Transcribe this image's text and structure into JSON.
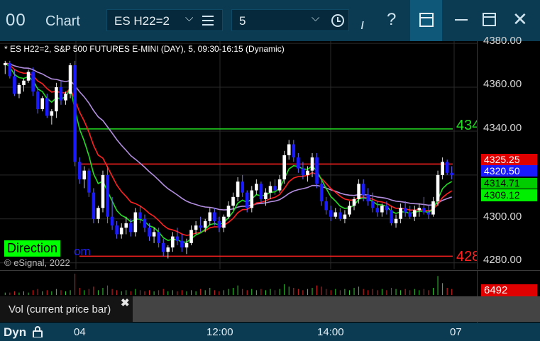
{
  "window": {
    "icon_text": "00",
    "title": "Chart",
    "symbol": "ES H22=2",
    "interval": "5"
  },
  "chart": {
    "header": "* ES H22=2, S&P 500 FUTURES E-MINI (DAY), 5, 09:30-16:15 (Dynamic)",
    "direction_label": "Direction",
    "direction_extra": "om",
    "copyright": "© eSignal, 2022",
    "green_line_label": "434",
    "red_line_label": "428",
    "price_ticks": [
      "4380.00",
      "4360.00",
      "4340.00",
      "4300.00",
      "4280.00"
    ],
    "badges": {
      "red_upper": "4325.25",
      "last_price": "4320.50",
      "green_upper": "4314.71",
      "green_lower": "4309.12"
    },
    "colors": {
      "up_candle": "#ffffff",
      "down_candle": "#1a1aff",
      "red_line": "#ff2020",
      "green_line": "#22dd22",
      "lavender_line": "#b38ee0"
    }
  },
  "volume": {
    "label": "Vol (current price bar)",
    "close": "✖",
    "value": "6492"
  },
  "time_axis": {
    "mode": "Dyn",
    "ticks": [
      "04",
      "12:00",
      "14:00",
      "07"
    ]
  },
  "chart_data": {
    "type": "candlestick",
    "ylim": [
      4277,
      4381
    ],
    "candles": [
      [
        4370,
        4372,
        4366,
        4371
      ],
      [
        4371,
        4372,
        4364,
        4365
      ],
      [
        4365,
        4368,
        4356,
        4357
      ],
      [
        4357,
        4362,
        4355,
        4361
      ],
      [
        4361,
        4364,
        4358,
        4363
      ],
      [
        4363,
        4368,
        4362,
        4367
      ],
      [
        4367,
        4369,
        4356,
        4358
      ],
      [
        4358,
        4360,
        4348,
        4350
      ],
      [
        4350,
        4356,
        4349,
        4355
      ],
      [
        4355,
        4357,
        4346,
        4347
      ],
      [
        4347,
        4350,
        4343,
        4349
      ],
      [
        4349,
        4362,
        4346,
        4360
      ],
      [
        4360,
        4363,
        4352,
        4354
      ],
      [
        4354,
        4358,
        4352,
        4357
      ],
      [
        4357,
        4371,
        4355,
        4370
      ],
      [
        4370,
        4372,
        4324,
        4326
      ],
      [
        4326,
        4328,
        4316,
        4318
      ],
      [
        4318,
        4324,
        4314,
        4322
      ],
      [
        4322,
        4323,
        4310,
        4312
      ],
      [
        4312,
        4314,
        4298,
        4300
      ],
      [
        4300,
        4306,
        4298,
        4305
      ],
      [
        4305,
        4322,
        4303,
        4320
      ],
      [
        4320,
        4324,
        4298,
        4301
      ],
      [
        4301,
        4310,
        4295,
        4297
      ],
      [
        4297,
        4299,
        4291,
        4293
      ],
      [
        4293,
        4298,
        4291,
        4296
      ],
      [
        4296,
        4301,
        4293,
        4298
      ],
      [
        4298,
        4300,
        4292,
        4294
      ],
      [
        4294,
        4305,
        4292,
        4303
      ],
      [
        4303,
        4306,
        4298,
        4300
      ],
      [
        4300,
        4302,
        4294,
        4296
      ],
      [
        4296,
        4298,
        4290,
        4292
      ],
      [
        4292,
        4296,
        4289,
        4294
      ],
      [
        4294,
        4296,
        4287,
        4289
      ],
      [
        4289,
        4291,
        4283,
        4285
      ],
      [
        4285,
        4288,
        4282,
        4287
      ],
      [
        4287,
        4294,
        4285,
        4292
      ],
      [
        4292,
        4296,
        4288,
        4290
      ],
      [
        4290,
        4293,
        4285,
        4287
      ],
      [
        4287,
        4291,
        4284,
        4289
      ],
      [
        4289,
        4297,
        4288,
        4295
      ],
      [
        4295,
        4299,
        4293,
        4297
      ],
      [
        4297,
        4301,
        4294,
        4296
      ],
      [
        4296,
        4300,
        4294,
        4299
      ],
      [
        4299,
        4305,
        4297,
        4303
      ],
      [
        4303,
        4305,
        4297,
        4299
      ],
      [
        4299,
        4301,
        4294,
        4296
      ],
      [
        4296,
        4302,
        4294,
        4301
      ],
      [
        4301,
        4308,
        4300,
        4306
      ],
      [
        4306,
        4312,
        4304,
        4310
      ],
      [
        4310,
        4319,
        4308,
        4317
      ],
      [
        4317,
        4320,
        4310,
        4312
      ],
      [
        4312,
        4313,
        4303,
        4305
      ],
      [
        4305,
        4315,
        4303,
        4313
      ],
      [
        4313,
        4318,
        4311,
        4316
      ],
      [
        4316,
        4317,
        4307,
        4309
      ],
      [
        4309,
        4314,
        4306,
        4312
      ],
      [
        4312,
        4317,
        4309,
        4315
      ],
      [
        4315,
        4318,
        4311,
        4313
      ],
      [
        4313,
        4320,
        4312,
        4318
      ],
      [
        4318,
        4331,
        4316,
        4329
      ],
      [
        4329,
        4336,
        4327,
        4334
      ],
      [
        4334,
        4336,
        4326,
        4328
      ],
      [
        4328,
        4330,
        4321,
        4323
      ],
      [
        4323,
        4326,
        4318,
        4320
      ],
      [
        4320,
        4324,
        4317,
        4322
      ],
      [
        4322,
        4330,
        4319,
        4328
      ],
      [
        4328,
        4330,
        4314,
        4316
      ],
      [
        4316,
        4318,
        4306,
        4308
      ],
      [
        4308,
        4310,
        4302,
        4304
      ],
      [
        4304,
        4306,
        4299,
        4301
      ],
      [
        4301,
        4305,
        4300,
        4303
      ],
      [
        4303,
        4305,
        4299,
        4300
      ],
      [
        4300,
        4304,
        4298,
        4302
      ],
      [
        4302,
        4308,
        4301,
        4306
      ],
      [
        4306,
        4310,
        4304,
        4309
      ],
      [
        4309,
        4318,
        4307,
        4316
      ],
      [
        4316,
        4318,
        4308,
        4311
      ],
      [
        4311,
        4314,
        4306,
        4308
      ],
      [
        4308,
        4312,
        4303,
        4305
      ],
      [
        4305,
        4308,
        4301,
        4303
      ],
      [
        4303,
        4307,
        4301,
        4306
      ],
      [
        4306,
        4308,
        4302,
        4304
      ],
      [
        4304,
        4306,
        4297,
        4298
      ],
      [
        4298,
        4302,
        4296,
        4300
      ],
      [
        4300,
        4307,
        4298,
        4305
      ],
      [
        4305,
        4308,
        4301,
        4303
      ],
      [
        4303,
        4306,
        4300,
        4301
      ],
      [
        4301,
        4306,
        4299,
        4304
      ],
      [
        4304,
        4307,
        4301,
        4305
      ],
      [
        4305,
        4310,
        4302,
        4303
      ],
      [
        4303,
        4306,
        4300,
        4302
      ],
      [
        4302,
        4310,
        4301,
        4308
      ],
      [
        4308,
        4322,
        4306,
        4320
      ],
      [
        4320,
        4328,
        4318,
        4326
      ],
      [
        4326,
        4327,
        4320,
        4321
      ],
      [
        4321,
        4324,
        4318,
        4320
      ]
    ],
    "horizontal_lines": [
      {
        "name": "green",
        "value": 4341
      },
      {
        "name": "red_upper",
        "value": 4325
      },
      {
        "name": "red_lower",
        "value": 4283
      }
    ],
    "volume": [
      2,
      2,
      3,
      2,
      3,
      2,
      4,
      5,
      3,
      4,
      3,
      5,
      4,
      3,
      4,
      18,
      6,
      4,
      5,
      7,
      4,
      6,
      8,
      5,
      4,
      3,
      4,
      3,
      5,
      4,
      3,
      4,
      3,
      4,
      5,
      3,
      4,
      3,
      4,
      3,
      4,
      3,
      5,
      4,
      6,
      4,
      3,
      4,
      5,
      6,
      8,
      5,
      4,
      5,
      4,
      5,
      4,
      5,
      4,
      5,
      9,
      7,
      6,
      5,
      4,
      5,
      6,
      8,
      7,
      5,
      4,
      5,
      4,
      5,
      4,
      6,
      7,
      5,
      4,
      5,
      4,
      5,
      4,
      6,
      5,
      4,
      5,
      4,
      5,
      4,
      5,
      4,
      6,
      16,
      10,
      6,
      5
    ]
  }
}
